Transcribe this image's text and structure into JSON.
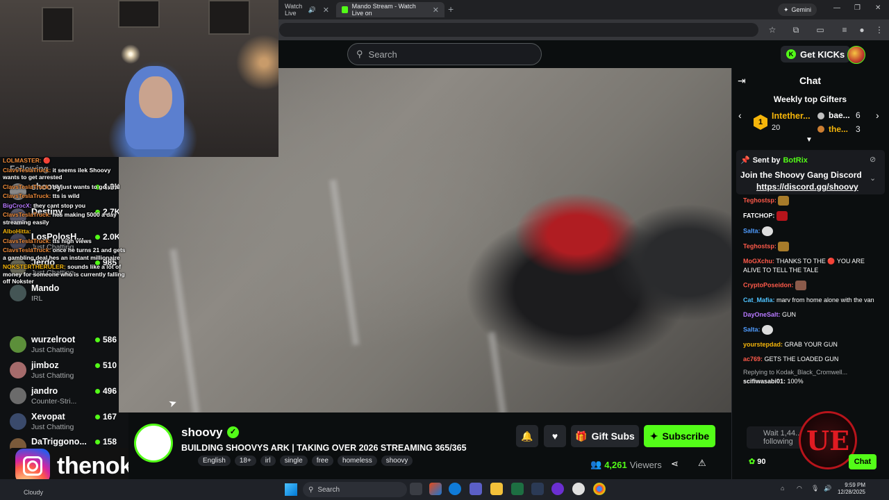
{
  "browser": {
    "tabs": [
      {
        "label": "Watch Live",
        "active": false
      },
      {
        "label": "Mando Stream - Watch Live on",
        "active": true
      }
    ],
    "gemini_label": "Gemini"
  },
  "header": {
    "search_placeholder": "Search",
    "get_kicks_label": "Get KICKs"
  },
  "sidebar": {
    "following_label": "Following",
    "channels": [
      {
        "name": "shoovy",
        "category": "",
        "viewers": "4.3K"
      },
      {
        "name": "Destiny",
        "category": "",
        "viewers": "2.7K"
      },
      {
        "name": "LosPolosH...",
        "category": "Just Chatting",
        "viewers": "2.0K"
      },
      {
        "name": "Jerdo",
        "category": "Just Chatting",
        "viewers": "985"
      },
      {
        "name": "Mando",
        "category": "IRL",
        "viewers": ""
      },
      {
        "name": "wurzelroot",
        "category": "Just Chatting",
        "viewers": "586"
      },
      {
        "name": "jimboz",
        "category": "Just Chatting",
        "viewers": "510"
      },
      {
        "name": "jandro",
        "category": "Counter-Stri...",
        "viewers": "496"
      },
      {
        "name": "Xevopat",
        "category": "Just Chatting",
        "viewers": "167"
      },
      {
        "name": "DaTriggono...",
        "category": "",
        "viewers": "158"
      }
    ]
  },
  "overlay_chat": [
    {
      "user": "LOLMASTER:",
      "text": "🔴"
    },
    {
      "user": "ClavsTeslaTruck:",
      "text": "it seems ilek Shoovy wants to get arrested"
    },
    {
      "user": "ClavsTeslaTruck:",
      "text": "he just wants to go viral"
    },
    {
      "user": "ClavsTeslaTruck:",
      "text": "tts is wild"
    },
    {
      "user": "BigCrocX:",
      "text": "they cant stop you"
    },
    {
      "user": "ClavsTeslaTruck:",
      "text": "hes making 5000 a day streaming easily"
    },
    {
      "user": "AlboHitta:",
      "text": ""
    },
    {
      "user": "ClavsTeslaTruck:",
      "text": "tts high views"
    },
    {
      "user": "ClavsTeslaTruck:",
      "text": "once he turns 21 and gets a gambling deal hes an instant millionaire"
    },
    {
      "user": "NOKSTERTHERULER:",
      "text": "sounds like a lot of money for someone who is currently falling off Nokster"
    }
  ],
  "instagram": {
    "handle": "thenokster"
  },
  "stream": {
    "streamer": "shoovy",
    "title": "BUILDING SHOOVYS ARK | TAKING OVER 2026 STREAMING 365/365",
    "tags": [
      "English",
      "18+",
      "irl",
      "single",
      "free",
      "homeless",
      "shoovy"
    ],
    "viewers": "4,261",
    "viewers_label": "Viewers",
    "gift_subs_label": "Gift Subs",
    "subscribe_label": "Subscribe"
  },
  "chat": {
    "title": "Chat",
    "weekly_gifters_title": "Weekly top Gifters",
    "top_gifter": {
      "rank": "1",
      "name": "Intether...",
      "count": "20"
    },
    "gifter2": {
      "name": "bae...",
      "count": "6"
    },
    "gifter3": {
      "name": "the...",
      "count": "3"
    },
    "pinned": {
      "sent_by": "Sent by",
      "bot_name": "BotRix",
      "message": "Join the Shoovy Gang Discord",
      "link": "https://discord.gg/shoovy"
    },
    "messages": [
      {
        "user": "Teghostsp:",
        "text": "",
        "color": "#ff5a4a"
      },
      {
        "user": "FATCHOP:",
        "text": "",
        "color": "#ffffff"
      },
      {
        "user": "Salta:",
        "text": "",
        "color": "#4f9cff"
      },
      {
        "user": "Teghostsp:",
        "text": "",
        "color": "#ff5a4a"
      },
      {
        "user": "MoGXchu:",
        "text": "THANKS TO THE 🔴 YOU ARE ALIVE TO TELL THE TALE",
        "color": "#ff5a4a"
      },
      {
        "user": "CryptoPoseidon:",
        "text": "",
        "color": "#ff5a4a"
      },
      {
        "user": "Cat_Mafia:",
        "text": "marv from home alone with the van",
        "color": "#4fc3ff"
      },
      {
        "user": "DayOneSalt:",
        "text": "GUN",
        "color": "#b779ff"
      },
      {
        "user": "Salta:",
        "text": "",
        "color": "#4f9cff"
      },
      {
        "user": "yourstepdad:",
        "text": "GRAB YOUR GUN",
        "color": "#f5b50a"
      },
      {
        "user": "ac769:",
        "text": "GETS THE LOADED GUN",
        "color": "#ff5a4a"
      }
    ],
    "reply_to": "Replying to Kodak_Black_Cromwell...",
    "last_message": {
      "user": "scifiwasabi01:",
      "text": "100%"
    },
    "input_placeholder": "Wait 1,44... following",
    "points": "90",
    "send_label": "Chat"
  },
  "taskbar": {
    "weather": "Cloudy",
    "search_label": "Search",
    "time": "9:59 PM",
    "date": "12/28/2025"
  },
  "colors": {
    "kick_green": "#53fc18",
    "bg": "#0b0e0f",
    "panel": "#191b1f"
  }
}
